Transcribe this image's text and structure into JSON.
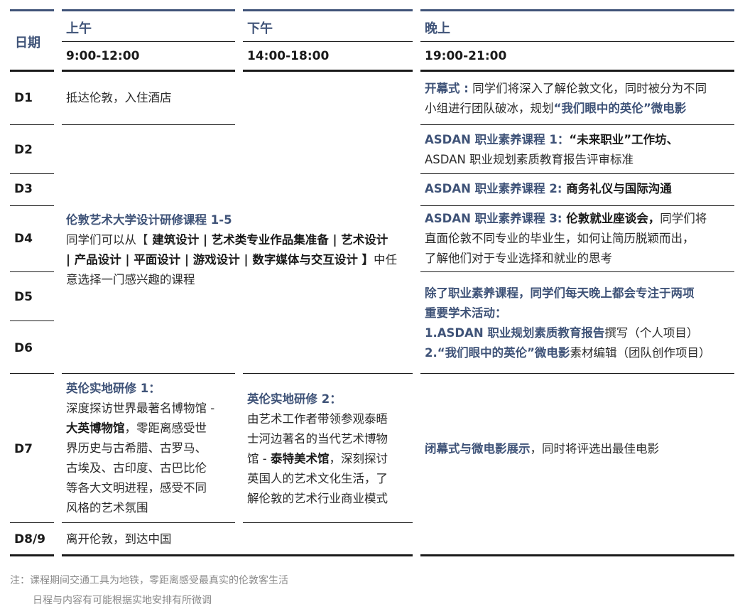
{
  "headers": {
    "date": "日期",
    "morning": "上午",
    "afternoon": "下午",
    "evening": "晚上",
    "morning_time": "9:00-12:00",
    "afternoon_time": "14:00-18:00",
    "evening_time": "19:00-21:00"
  },
  "days": [
    "D1",
    "D2",
    "D3",
    "D4",
    "D5",
    "D6",
    "D7",
    "D8/9"
  ],
  "d1": {
    "morning": "抵达伦敦，入住酒店",
    "evening_title": "开幕式 :",
    "evening_text1": " 同学们将深入了解伦敦文化，同时被分为不同",
    "evening_text2": "小组进行团队破冰，规划",
    "evening_highlight": "“我们眼中的英伦”",
    "evening_tail": "微电影"
  },
  "d2": {
    "title": "ASDAN 职业素养课程 1：",
    "title_bold": "“未来职业”工作坊、",
    "text": "ASDAN 职业规划素质教育报告评审标准"
  },
  "d3": {
    "title": "ASDAN 职业素养课程 2:",
    "title_bold": " 商务礼仪与国际沟通"
  },
  "d4": {
    "title": "ASDAN 职业素养课程 3:",
    "title_bold": " 伦敦就业座谈会，",
    "text1": "同学们将",
    "text2": "直面伦敦不同专业的毕业生，如何让简历脱颖而出，",
    "text3": "了解他们对于专业选择和就业的思考"
  },
  "course": {
    "title": "伦敦艺术大学设计研修课程 1-5",
    "intro": "同学们可以从【",
    "l1": " 建筑设计 | 艺术类专业作品集准备 | 艺术设计",
    "l2": "| 产品设计 | 平面设计 | 游戏设计 | 数字媒体与交互设计 】",
    "l2tail": "中任",
    "l3": "意选择一门感兴趣的课程"
  },
  "d56": {
    "l1": "除了职业素养课程，同学们每天晚上都会专注于两项",
    "l2": "重要学术活动：",
    "l3a": "1.ASDAN 职业规划素质教育报告",
    "l3b": "撰写（个人项目）",
    "l4a": "2.“我们眼中的英伦”微电影",
    "l4b": "素材编辑（团队创作项目）"
  },
  "d7": {
    "m_title": "英伦实地研修 1：",
    "m1": "深度探访世界最著名博物馆 -",
    "m2a": "大英博物馆",
    "m2b": "，零距离感受世",
    "m3": "界历史与古希腊、古罗马、",
    "m4": "古埃及、古印度、古巴比伦",
    "m5": "等各大文明进程，感受不同",
    "m6": "风格的艺术氛围",
    "a_title": "英伦实地研修 2：",
    "a1": "由艺术工作者带领参观泰晤",
    "a2": "士河边著名的当代艺术博物",
    "a3a": "馆 - ",
    "a3b": "泰特美术馆",
    "a3c": "，深刻探讨",
    "a4": "英国人的艺术文化生活，了",
    "a5": "解伦敦的艺术行业商业模式",
    "e_title": "闭幕式与微电影展示",
    "e_text": "，同时将评选出最佳电影"
  },
  "d89": {
    "morning": "离开伦敦，到达中国"
  },
  "notes": {
    "n1": "注：课程期间交通工具为地铁，零距离感受最真实的伦敦客生活",
    "n2": "日程与内容有可能根据实地安排有所微调"
  },
  "colors": {
    "accent": "#3f5378",
    "text": "#2b2b2b",
    "rule": "#1a1a1a",
    "note": "#8a8a8a"
  }
}
